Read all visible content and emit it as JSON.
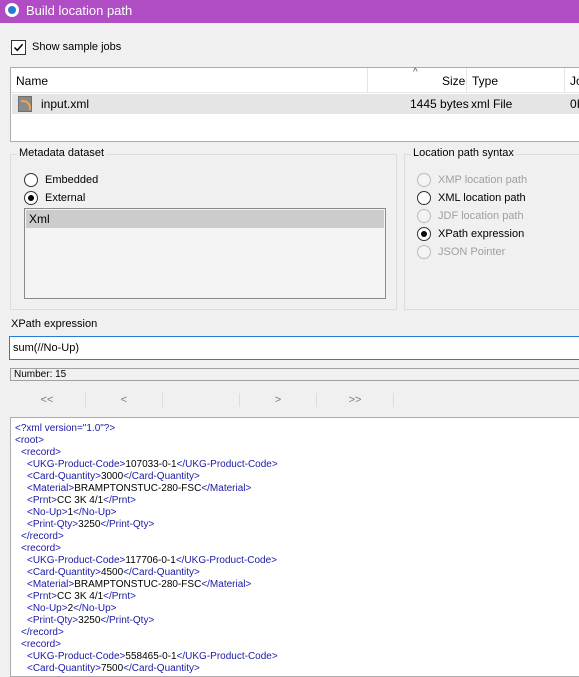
{
  "window": {
    "title": "Build location path"
  },
  "show_sample_jobs": {
    "label": "Show sample jobs",
    "checked": true
  },
  "file_list": {
    "columns": [
      "Name",
      "Size",
      "Type",
      "Jo"
    ],
    "rows": [
      {
        "name": "input.xml",
        "size": "1445 bytes",
        "type": "xml File",
        "extra": "0I"
      }
    ]
  },
  "metadata_dataset": {
    "legend": "Metadata dataset",
    "options": [
      {
        "label": "Embedded",
        "checked": false
      },
      {
        "label": "External",
        "checked": true
      }
    ],
    "datasets": [
      "Xml"
    ]
  },
  "location_path_syntax": {
    "legend": "Location path syntax",
    "options": [
      {
        "label": "XMP location path",
        "enabled": false,
        "checked": false
      },
      {
        "label": "XML location path",
        "enabled": true,
        "checked": false
      },
      {
        "label": "JDF location path",
        "enabled": false,
        "checked": false
      },
      {
        "label": "XPath expression",
        "enabled": true,
        "checked": true
      },
      {
        "label": "JSON Pointer",
        "enabled": false,
        "checked": false
      }
    ]
  },
  "xpath": {
    "label": "XPath expression",
    "value": "sum(//No-Up)"
  },
  "result": {
    "text": "Number: 15"
  },
  "nav": {
    "first": "<<",
    "prev": "<",
    "next": ">",
    "last": ">>"
  },
  "xml_preview": {
    "declaration": "<?xml version=\"1.0\"?>",
    "root_open": "<root>",
    "record_open": "<record>",
    "record_close": "</record>",
    "records": [
      {
        "fields": [
          {
            "tag": "UKG-Product-Code",
            "value": "107033-0-1"
          },
          {
            "tag": "Card-Quantity",
            "value": "3000"
          },
          {
            "tag": "Material",
            "value": "BRAMPTONSTUC-280-FSC"
          },
          {
            "tag": "Prnt",
            "value": "CC 3K 4/1"
          },
          {
            "tag": "No-Up",
            "value": "1"
          },
          {
            "tag": "Print-Qty",
            "value": "3250"
          }
        ]
      },
      {
        "fields": [
          {
            "tag": "UKG-Product-Code",
            "value": "117706-0-1"
          },
          {
            "tag": "Card-Quantity",
            "value": "4500"
          },
          {
            "tag": "Material",
            "value": "BRAMPTONSTUC-280-FSC"
          },
          {
            "tag": "Prnt",
            "value": "CC 3K 4/1"
          },
          {
            "tag": "No-Up",
            "value": "2"
          },
          {
            "tag": "Print-Qty",
            "value": "3250"
          }
        ]
      },
      {
        "fields": [
          {
            "tag": "UKG-Product-Code",
            "value": "558465-0-1"
          },
          {
            "tag": "Card-Quantity",
            "value": "7500"
          }
        ]
      }
    ]
  }
}
